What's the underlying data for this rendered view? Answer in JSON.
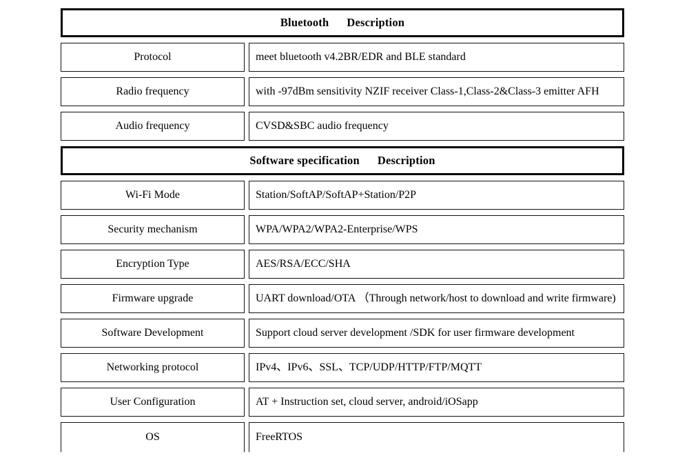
{
  "document": {
    "title": "Bluetooth and Software Specification Table",
    "background_color": "#ffffff",
    "text_color": "#000000"
  },
  "sections": [
    {
      "header": {
        "left": "Bluetooth",
        "right": "Description"
      },
      "rows": [
        {
          "label": "Protocol",
          "value": "meet bluetooth v4.2BR/EDR and BLE standard"
        },
        {
          "label": "Radio frequency",
          "value": "with -97dBm sensitivity NZIF receiver Class-1,Class-2&Class-3 emitter AFH"
        },
        {
          "label": "Audio frequency",
          "value": "CVSD&SBC audio frequency"
        }
      ]
    },
    {
      "header": {
        "left": "Software specification",
        "right": "Description"
      },
      "rows": [
        {
          "label": "Wi-Fi Mode",
          "value": "Station/SoftAP/SoftAP+Station/P2P"
        },
        {
          "label": "Security mechanism",
          "value": "WPA/WPA2/WPA2-Enterprise/WPS"
        },
        {
          "label": "Encryption Type",
          "value": "AES/RSA/ECC/SHA"
        },
        {
          "label": "Firmware upgrade",
          "value": "UART download/OTA （Through network/host to download and write firmware)"
        },
        {
          "label": "Software Development",
          "value": "Support cloud server development /SDK for user firmware development"
        },
        {
          "label": "Networking protocol",
          "value": "IPv4、IPv6、SSL、TCP/UDP/HTTP/FTP/MQTT"
        },
        {
          "label": "User Configuration",
          "value": "AT + Instruction set, cloud server, android/iOSapp"
        },
        {
          "label": "OS",
          "value": "FreeRTOS"
        }
      ]
    }
  ]
}
